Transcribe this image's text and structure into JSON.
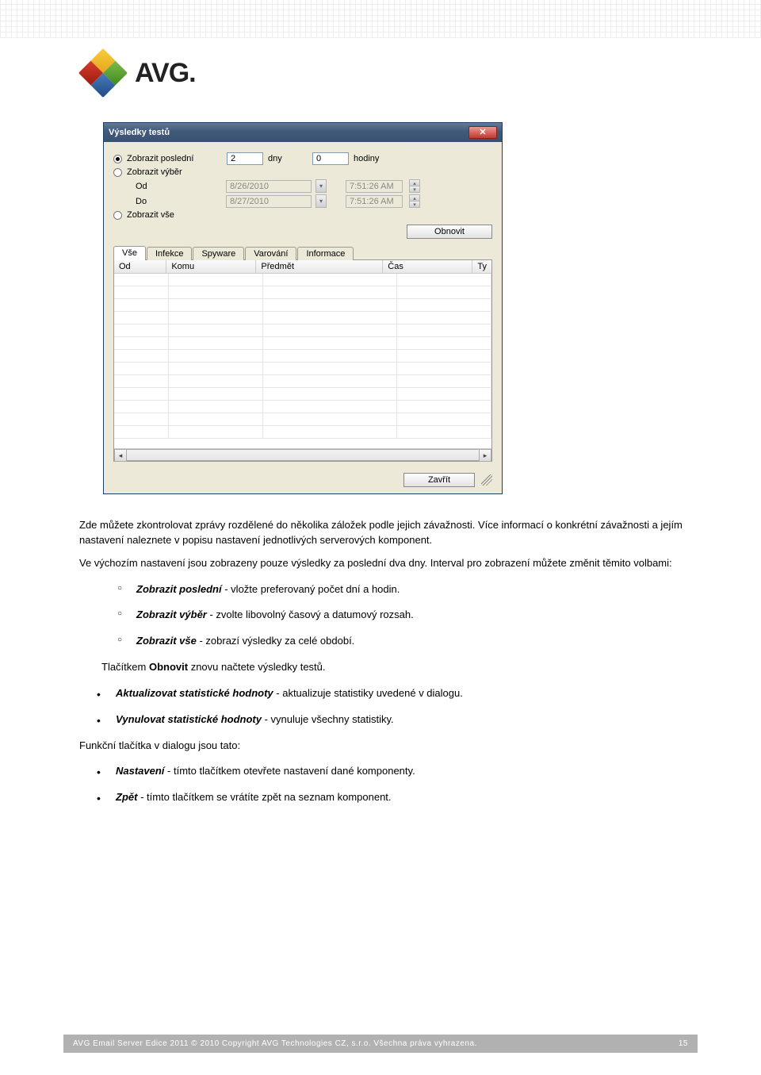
{
  "logo": {
    "brand": "AVG."
  },
  "dialog": {
    "title": "Výsledky testů",
    "radios": {
      "last": "Zobrazit poslední",
      "range": "Zobrazit výběr",
      "all": "Zobrazit vše"
    },
    "range_labels": {
      "from": "Od",
      "to": "Do"
    },
    "fields": {
      "days_value": "2",
      "days_unit": "dny",
      "hours_value": "0",
      "hours_unit": "hodiny",
      "from_date": "8/26/2010",
      "from_time": "7:51:26 AM",
      "to_date": "8/27/2010",
      "to_time": "7:51:26 AM"
    },
    "refresh_btn": "Obnovit",
    "tabs": [
      "Vše",
      "Infekce",
      "Spyware",
      "Varování",
      "Informace"
    ],
    "columns": {
      "od": "Od",
      "komu": "Komu",
      "predmet": "Předmět",
      "cas": "Čas",
      "ty": "Ty"
    },
    "close_btn": "Zavřít"
  },
  "doc": {
    "intro": "Zde můžete zkontrolovat zprávy rozdělené do několika záložek podle jejich závažnosti. Více informací o konkrétní závažnosti a jejím nastavení naleznete v popisu nastavení jednotlivých serverových komponent.",
    "default": "Ve výchozím nastavení jsou zobrazeny pouze výsledky za poslední dva dny. Interval pro zobrazení můžete změnit těmito volbami:",
    "opts": {
      "last_b": "Zobrazit poslední",
      "last_rest": " - vložte preferovaný počet dní a hodin.",
      "range_b": "Zobrazit výběr",
      "range_rest": " - zvolte libovolný časový a datumový rozsah.",
      "all_b": "Zobrazit vše",
      "all_rest": " - zobrazí výsledky za celé období."
    },
    "refresh_pre": "Tlačítkem ",
    "refresh_b": "Obnovit",
    "refresh_post": " znovu načtete výsledky testů.",
    "actions": {
      "update_b": "Aktualizovat statistické hodnoty",
      "update_rest": " - aktualizuje statistiky uvedené v dialogu.",
      "reset_b": "Vynulovat statistické hodnoty",
      "reset_rest": " - vynuluje všechny statistiky."
    },
    "func_intro": "Funkční tlačítka v dialogu jsou tato:",
    "func": {
      "settings_b": "Nastavení",
      "settings_rest": " - tímto tlačítkem otevřete nastavení dané komponenty.",
      "back_b": "Zpět",
      "back_rest": " - tímto tlačítkem se vrátíte zpět na seznam komponent."
    }
  },
  "footer": {
    "left": "AVG Email Server Edice 2011 © 2010 Copyright AVG Technologies CZ, s.r.o. Všechna práva vyhrazena.",
    "page": "15"
  }
}
